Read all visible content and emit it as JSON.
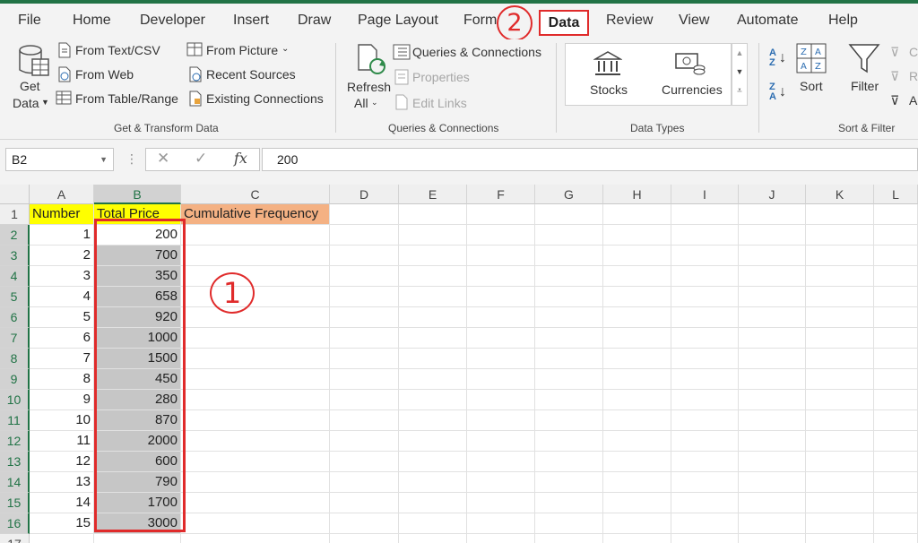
{
  "tabs": [
    "File",
    "Home",
    "Developer",
    "Insert",
    "Draw",
    "Page Layout",
    "Form",
    "Data",
    "Review",
    "View",
    "Automate",
    "Help"
  ],
  "annotations": {
    "step1": "1",
    "step2": "2"
  },
  "ribbon": {
    "get_data": {
      "line1": "Get",
      "line2": "Data"
    },
    "from_text_csv": "From Text/CSV",
    "from_web": "From Web",
    "from_table_range": "From Table/Range",
    "from_picture": "From Picture",
    "recent_sources": "Recent Sources",
    "existing_connections": "Existing Connections",
    "group_get_transform": "Get & Transform Data",
    "refresh": {
      "line1": "Refresh",
      "line2": "All"
    },
    "queries_connections": "Queries & Connections",
    "properties": "Properties",
    "edit_links": "Edit Links",
    "group_queries": "Queries & Connections",
    "stocks": "Stocks",
    "currencies": "Currencies",
    "group_data_types": "Data Types",
    "sort": "Sort",
    "filter": "Filter",
    "group_sort_filter": "Sort & Filter",
    "sort_az": {
      "a": "A",
      "z": "Z"
    },
    "sort_za": {
      "z": "Z",
      "a": "A"
    },
    "clear_partial": "Cl",
    "reapply_partial": "R",
    "advanced_partial": "A"
  },
  "formula_bar": {
    "name_box": "B2",
    "fx": "fx",
    "formula": "200"
  },
  "columns": [
    "A",
    "B",
    "C",
    "D",
    "E",
    "F",
    "G",
    "H",
    "I",
    "J",
    "K",
    "L"
  ],
  "rows": [
    "1",
    "2",
    "3",
    "4",
    "5",
    "6",
    "7",
    "8",
    "9",
    "10",
    "11",
    "12",
    "13",
    "14",
    "15",
    "16",
    "17"
  ],
  "headers": {
    "a1": "Number",
    "b1": "Total Price",
    "c1": "Cumulative Frequency"
  },
  "data_rows": [
    {
      "number": "1",
      "price": "200"
    },
    {
      "number": "2",
      "price": "700"
    },
    {
      "number": "3",
      "price": "350"
    },
    {
      "number": "4",
      "price": "658"
    },
    {
      "number": "5",
      "price": "920"
    },
    {
      "number": "6",
      "price": "1000"
    },
    {
      "number": "7",
      "price": "1500"
    },
    {
      "number": "8",
      "price": "450"
    },
    {
      "number": "9",
      "price": "280"
    },
    {
      "number": "10",
      "price": "870"
    },
    {
      "number": "11",
      "price": "2000"
    },
    {
      "number": "12",
      "price": "600"
    },
    {
      "number": "13",
      "price": "790"
    },
    {
      "number": "14",
      "price": "1700"
    },
    {
      "number": "15",
      "price": "3000"
    }
  ],
  "colors": {
    "accent": "#217346",
    "highlight_red": "#e02b2b",
    "header_yellow": "#ffff00",
    "header_orange": "#f4b183",
    "selection_gray": "#c6c6c6"
  }
}
